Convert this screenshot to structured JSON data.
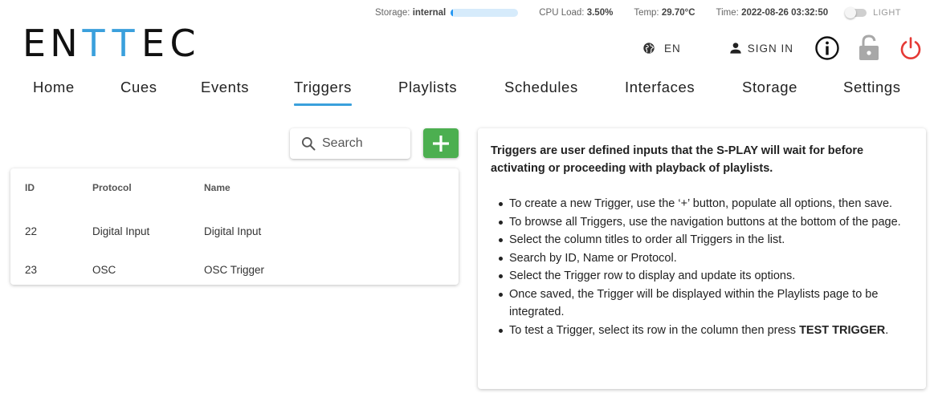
{
  "status": {
    "storage_label": "Storage:",
    "storage_value": "internal",
    "storage_fill_percent": 3,
    "cpu_label": "CPU Load:",
    "cpu_value": "3.50%",
    "temp_label": "Temp:",
    "temp_value": "29.70°C",
    "time_label": "Time:",
    "time_value": "2022-08-26 03:32:50",
    "theme_label": "LIGHT",
    "theme_dark_enabled": false
  },
  "logo": {
    "letters": [
      "E",
      "N",
      "T",
      "T",
      "E",
      "C"
    ]
  },
  "header": {
    "language": "EN",
    "signin_label": "SIGN IN"
  },
  "icons": {
    "globe": "globe-icon",
    "person": "person-icon",
    "info": "info-icon",
    "lock": "lock-icon",
    "power": "power-icon",
    "search": "search-icon",
    "add": "plus-icon"
  },
  "colors": {
    "accent": "#3aa0dc",
    "add_button": "#4caf50",
    "power": "#e53935",
    "lock": "#a8a8a8"
  },
  "nav": {
    "items": [
      "Home",
      "Cues",
      "Events",
      "Triggers",
      "Playlists",
      "Schedules",
      "Interfaces",
      "Storage",
      "Settings"
    ],
    "active": "Triggers"
  },
  "search": {
    "placeholder": "Search",
    "value": ""
  },
  "table": {
    "headers": [
      "ID",
      "Protocol",
      "Name"
    ],
    "rows": [
      [
        "22",
        "Digital Input",
        "Digital Input"
      ],
      [
        "23",
        "OSC",
        "OSC Trigger"
      ]
    ]
  },
  "info": {
    "title": "Triggers are user defined inputs that the S-PLAY will wait for before activating or proceeding with playback of playlists.",
    "bullets": [
      "To create a new Trigger, use the ‘+’ button, populate all options, then save.",
      "To browse all Triggers, use the navigation buttons at the bottom of the page.",
      "Select the column titles to order all Triggers in the list.",
      "Search by ID, Name or Protocol.",
      "Select the Trigger row to display and update its options.",
      "Once saved, the Trigger will be displayed within the Playlists page to be integrated."
    ],
    "last_bullet_prefix": "To test a Trigger, select its row in the column then press ",
    "last_bullet_bold": "TEST TRIGGER",
    "last_bullet_suffix": "."
  }
}
